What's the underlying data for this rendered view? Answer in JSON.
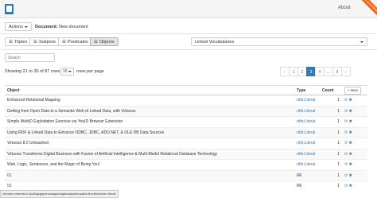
{
  "header": {
    "about": "About",
    "ribbon": "Fork me on GitHub"
  },
  "doc": {
    "actions_label": "Actions",
    "document_label": "Document:",
    "document_name": "New document"
  },
  "tabs": [
    {
      "label": "Triples",
      "icon": "list-icon"
    },
    {
      "label": "Subjects",
      "icon": "list-icon"
    },
    {
      "label": "Predicates",
      "icon": "list-icon"
    },
    {
      "label": "Objects",
      "icon": "list-icon",
      "active": true
    }
  ],
  "vocab": {
    "label": "Linked Vocabularies"
  },
  "search": {
    "placeholder": "Search"
  },
  "paging": {
    "showing": "Showing 21 to 30 of 87 rows",
    "page_size": "10",
    "rows_per_page": "rows per page",
    "pages": [
      "‹",
      "1",
      "2",
      "3",
      "4",
      "...",
      "9",
      "›"
    ],
    "active_page": "3"
  },
  "table": {
    "headers": {
      "object": "Object",
      "type": "Type",
      "count": "Count",
      "new": "+ New"
    },
    "rows": [
      {
        "object": "Enhanced Relational Mapping",
        "type": "rdfs:Literal",
        "count": "1"
      },
      {
        "object": "Getting from Open Data to a Semantic Web of Linked Data, with Virtuoso",
        "type": "rdfs:Literal",
        "count": "1"
      },
      {
        "object": "Simple WebID Exploitation Exercise via YouID Browser Extension",
        "type": "rdfs:Literal",
        "count": "1"
      },
      {
        "object": "Using RDF & Linked Data to Enhance ODBC, JDBC, ADO.NET, & OLE DB Data Sources",
        "type": "rdfs:Literal",
        "count": "1"
      },
      {
        "object": "Virtuoso 8.0 Unleashed",
        "type": "rdfs:Literal",
        "count": "1"
      },
      {
        "object": "Virtuoso Transforms Digital Business with Fusion of Artificial Intelligence & Multi-Model Relational Database Technology",
        "type": "rdfs:Literal",
        "count": "1"
      },
      {
        "object": "Web, Logic, Sentences, and the Magic of Being You!",
        "type": "rdfs:Literal",
        "count": "1"
      },
      {
        "object": "62",
        "type": "IRI",
        "count": "1"
      },
      {
        "object": "53",
        "type": "IRI",
        "count": "1"
      }
    ]
  },
  "status": {
    "url": "chrome-extension://pdlogcgkpchcoeapkcbgdmalpomimpak/rdf-editor/index.html#"
  },
  "colors": {
    "accent": "#337ab7",
    "ribbon": "#e86c1c",
    "link_green": "#2a7a2a"
  }
}
